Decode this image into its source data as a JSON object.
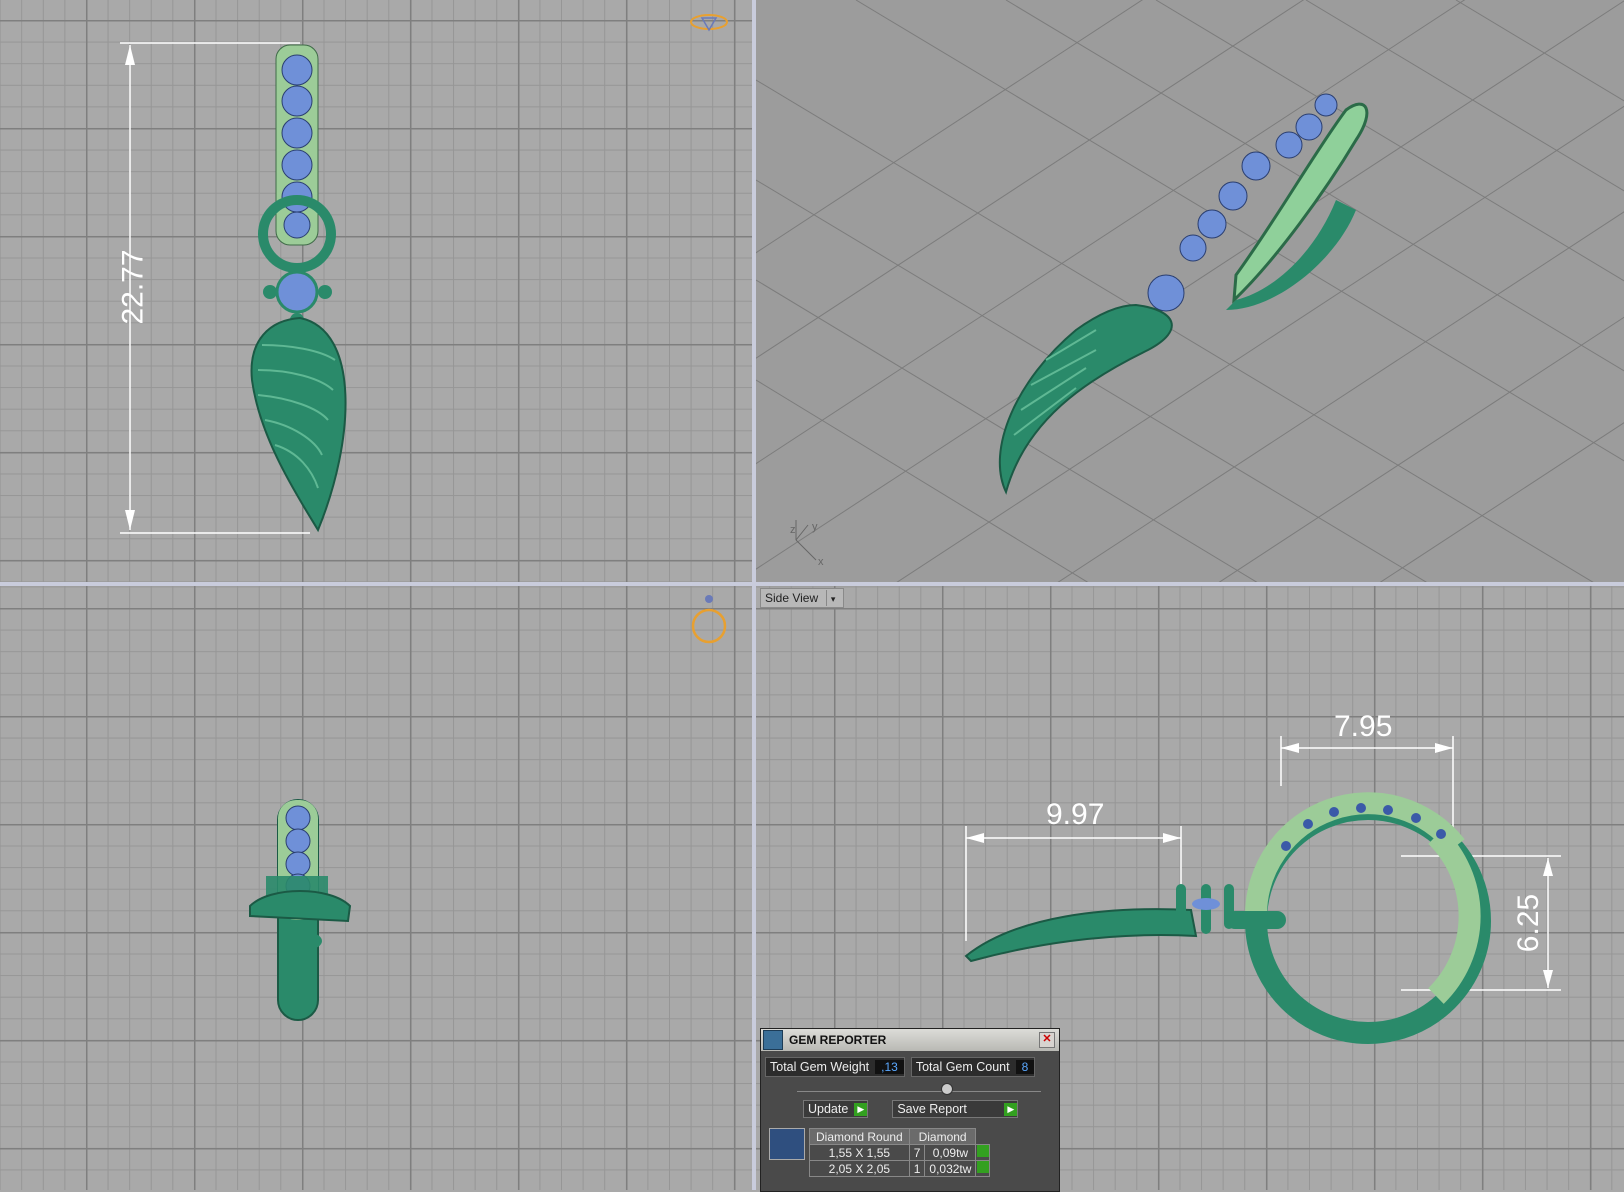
{
  "viewports": {
    "top": {
      "dimension": "22.77"
    },
    "side": {
      "label": "Side View",
      "dims": {
        "width_pendant": "9.97",
        "width_hoop": "7.95",
        "height_hoop": "6.25"
      }
    },
    "perspective": {
      "axis_labels": {
        "z": "z",
        "y": "y",
        "x": "x"
      }
    }
  },
  "gem_reporter": {
    "title": "GEM REPORTER",
    "total_weight_label": "Total Gem Weight",
    "total_weight_value": ",13",
    "total_count_label": "Total Gem Count",
    "total_count_value": "8",
    "update_label": "Update",
    "save_report_label": "Save Report",
    "table_headers": [
      "Diamond Round",
      "Diamond"
    ],
    "rows": [
      {
        "size": "1,55 X 1,55",
        "count": "7",
        "weight": "0,09tw"
      },
      {
        "size": "2,05 X 2,05",
        "count": "1",
        "weight": "0,032tw"
      }
    ]
  },
  "colors": {
    "metal": "#2a8a6a",
    "hoop_light": "#8fd09a",
    "gem": "#6f90d8",
    "accent": "#e8a030"
  }
}
